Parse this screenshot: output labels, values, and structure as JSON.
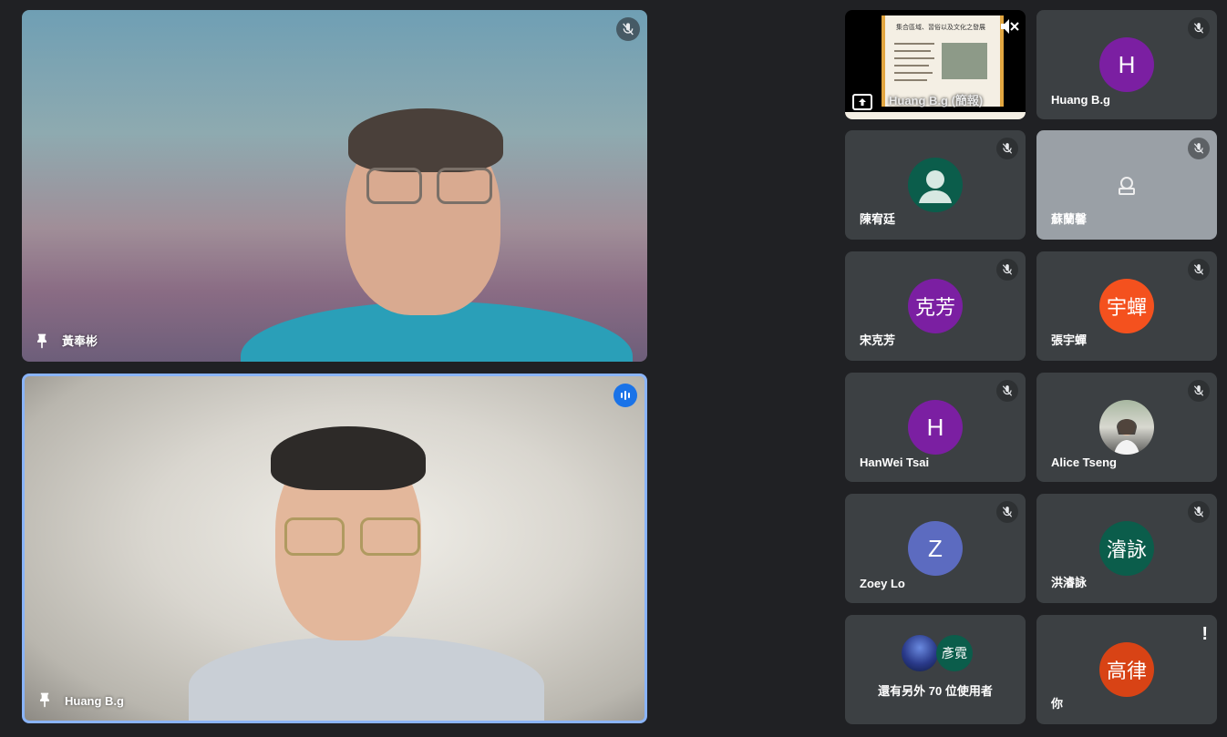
{
  "main_tiles": [
    {
      "name": "黃奉彬",
      "status": "muted"
    },
    {
      "name": "Huang B.g",
      "status": "speaking"
    }
  ],
  "presentation_tile": {
    "name": "Huang B.g (簡報)"
  },
  "grid_tiles": [
    {
      "name": "Huang B.g",
      "avatar_text": "H",
      "avatar_color": "#7b1fa2"
    },
    {
      "name": "陳宥廷",
      "avatar_text": "",
      "avatar_color": "#0b5d4b"
    },
    {
      "name": "蘇蘭馨",
      "avatar_text": "",
      "avatar_color": ""
    },
    {
      "name": "宋克芳",
      "avatar_text": "克芳",
      "avatar_color": "#7b1fa2"
    },
    {
      "name": "張宇蟬",
      "avatar_text": "宇蟬",
      "avatar_color": "#f4511e"
    },
    {
      "name": "HanWei Tsai",
      "avatar_text": "H",
      "avatar_color": "#7b1fa2"
    },
    {
      "name": "Alice Tseng",
      "avatar_text": "",
      "avatar_color": ""
    },
    {
      "name": "Zoey Lo",
      "avatar_text": "Z",
      "avatar_color": "#5c6bc0"
    },
    {
      "name": "洪濬詠",
      "avatar_text": "濬詠",
      "avatar_color": "#0b5d4b"
    }
  ],
  "more_tile": {
    "text": "還有另外 70 位使用者",
    "avatar_text": "彥霓"
  },
  "self_tile": {
    "name": "你",
    "avatar_text": "高律",
    "avatar_color": "#d84315"
  },
  "slide_title": "集合區域、習俗以及文化之發展"
}
